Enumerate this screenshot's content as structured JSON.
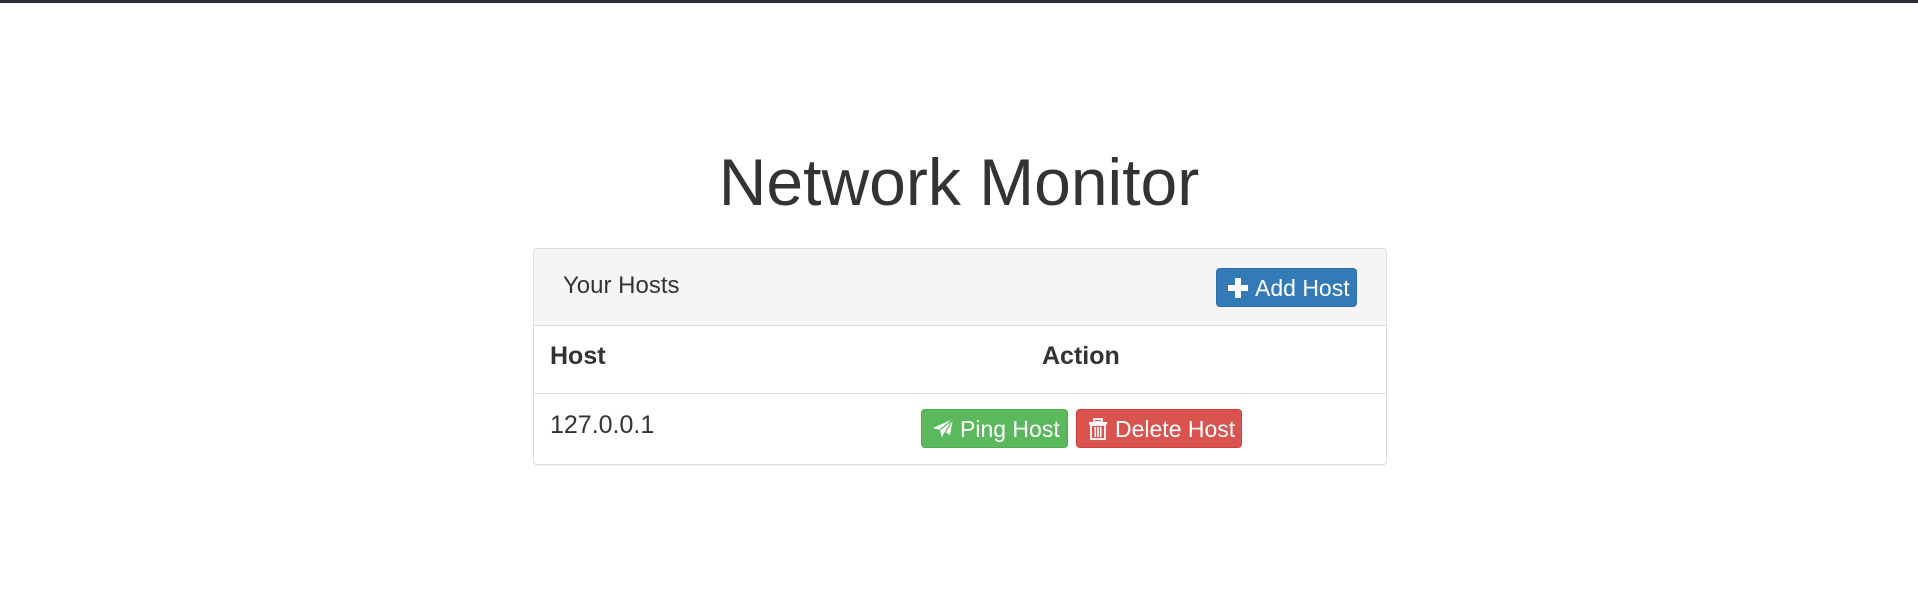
{
  "page": {
    "title": "Network Monitor"
  },
  "panel": {
    "title": "Your Hosts",
    "add_button_label": "Add Host"
  },
  "table": {
    "headers": [
      "Host",
      "Action"
    ],
    "rows": [
      {
        "host": "127.0.0.1",
        "ping_label": "Ping Host",
        "delete_label": "Delete Host"
      }
    ]
  },
  "icons": {
    "add": "plus-icon",
    "ping": "paper-plane-icon",
    "delete": "trash-icon"
  },
  "colors": {
    "primary": "#337ab7",
    "success": "#5cb85c",
    "danger": "#d9534f",
    "top_bar": "#2b2b3a"
  }
}
